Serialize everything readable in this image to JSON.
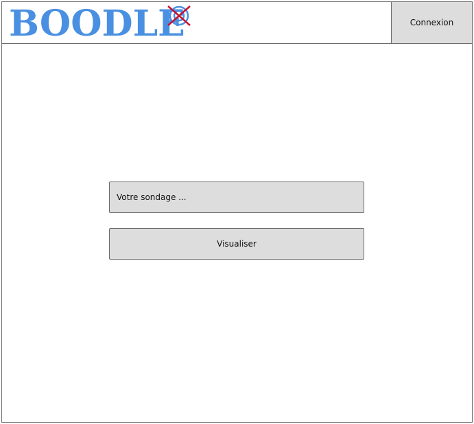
{
  "header": {
    "logo_text": "BOODLE",
    "logo_icon": "crossed-target-icon",
    "login_label": "Connexion"
  },
  "main": {
    "poll_input": {
      "value": "",
      "placeholder": "Votre sondage ..."
    },
    "view_button_label": "Visualiser"
  },
  "colors": {
    "logo_blue": "#4a90e2",
    "logo_cross_red": "#c8102e",
    "button_gray": "#dddddd",
    "border_gray": "#6b6b6b"
  }
}
